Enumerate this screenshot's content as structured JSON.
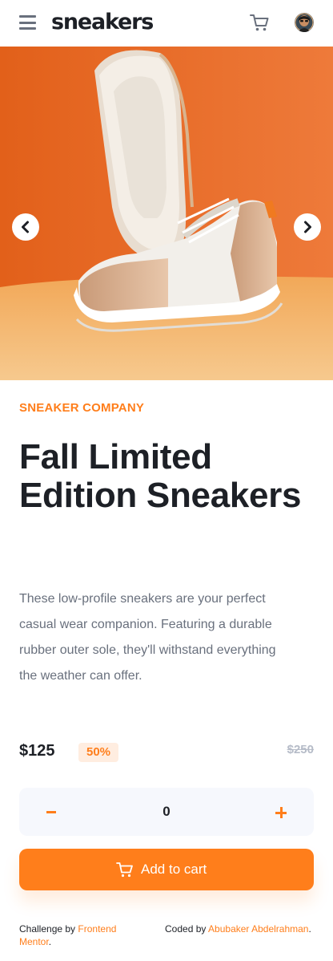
{
  "header": {
    "brand": "sneakers",
    "menu_icon": "hamburger-menu-icon",
    "cart_icon": "cart-icon",
    "avatar": "user-avatar"
  },
  "gallery": {
    "prev_icon": "chevron-left-icon",
    "next_icon": "chevron-right-icon"
  },
  "product": {
    "company": "SNEAKER COMPANY",
    "title": "Fall Limited Edition Sneakers",
    "description": "These low-profile sneakers are your perfect casual wear companion. Featuring a durable rubber outer sole, they'll withstand everything the weather can offer.",
    "price": "$125",
    "discount": "50%",
    "old_price": "$250"
  },
  "quantity": {
    "value": "0",
    "minus_icon": "minus-icon",
    "plus_icon": "plus-icon"
  },
  "add_to_cart": {
    "label": "Add to cart",
    "icon": "cart-icon"
  },
  "footer": {
    "challenge_prefix": "Challenge by ",
    "challenge_link": "Frontend Mentor",
    "challenge_suffix": ".",
    "coded_prefix": "Coded by ",
    "coded_link": "Abubaker Abdelrahman",
    "coded_suffix": "."
  },
  "colors": {
    "accent": "#ff7e1b",
    "accent_pale": "#ffede0",
    "text_dark": "#1d2026",
    "text_grey": "#69707d",
    "muted": "#b6bcc8",
    "qty_bg": "#f6f8fd"
  }
}
